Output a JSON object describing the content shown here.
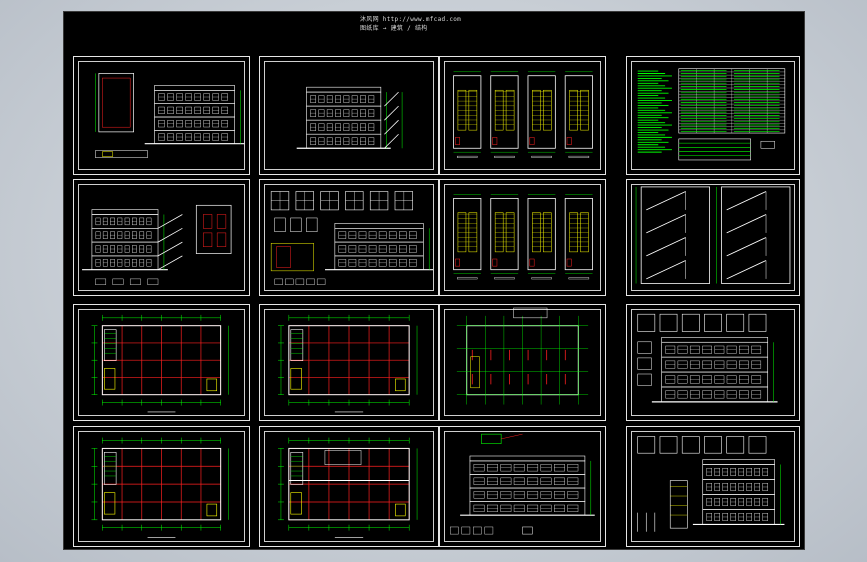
{
  "header": {
    "line1": "沐风网  http://www.mfcad.com",
    "line2": "图纸库 → 建筑 / 结构"
  },
  "colors": {
    "background": "#c9cfd6",
    "model_space": "#000000",
    "sheet_border": "#e6e6e6",
    "dimension": "#00ff00",
    "axis": "#ff2020",
    "wall": "#ffffff",
    "accent": "#ffff00",
    "text": "#00ffff"
  },
  "sheets": [
    {
      "name": "sheet-section-elevation",
      "kind": "elev_small"
    },
    {
      "name": "sheet-side-elevation",
      "kind": "side_elev"
    },
    {
      "name": "sheet-stair-plans",
      "kind": "stairs4"
    },
    {
      "name": "sheet-design-notes",
      "kind": "notes"
    },
    {
      "name": "sheet-section-detail",
      "kind": "section"
    },
    {
      "name": "sheet-window-details",
      "kind": "windows"
    },
    {
      "name": "sheet-stair-plans-2",
      "kind": "stairs4b"
    },
    {
      "name": "sheet-stair-sections",
      "kind": "stair_sec"
    },
    {
      "name": "sheet-floor-plan-1",
      "kind": "plan"
    },
    {
      "name": "sheet-floor-plan-2",
      "kind": "plan"
    },
    {
      "name": "sheet-roof-plan",
      "kind": "roof"
    },
    {
      "name": "sheet-front-elevation",
      "kind": "elev_front"
    },
    {
      "name": "sheet-floor-plan-3",
      "kind": "plan"
    },
    {
      "name": "sheet-floor-plan-4",
      "kind": "plan2"
    },
    {
      "name": "sheet-main-elevation",
      "kind": "elev_main"
    },
    {
      "name": "sheet-rear-elevation",
      "kind": "elev_rear"
    }
  ]
}
